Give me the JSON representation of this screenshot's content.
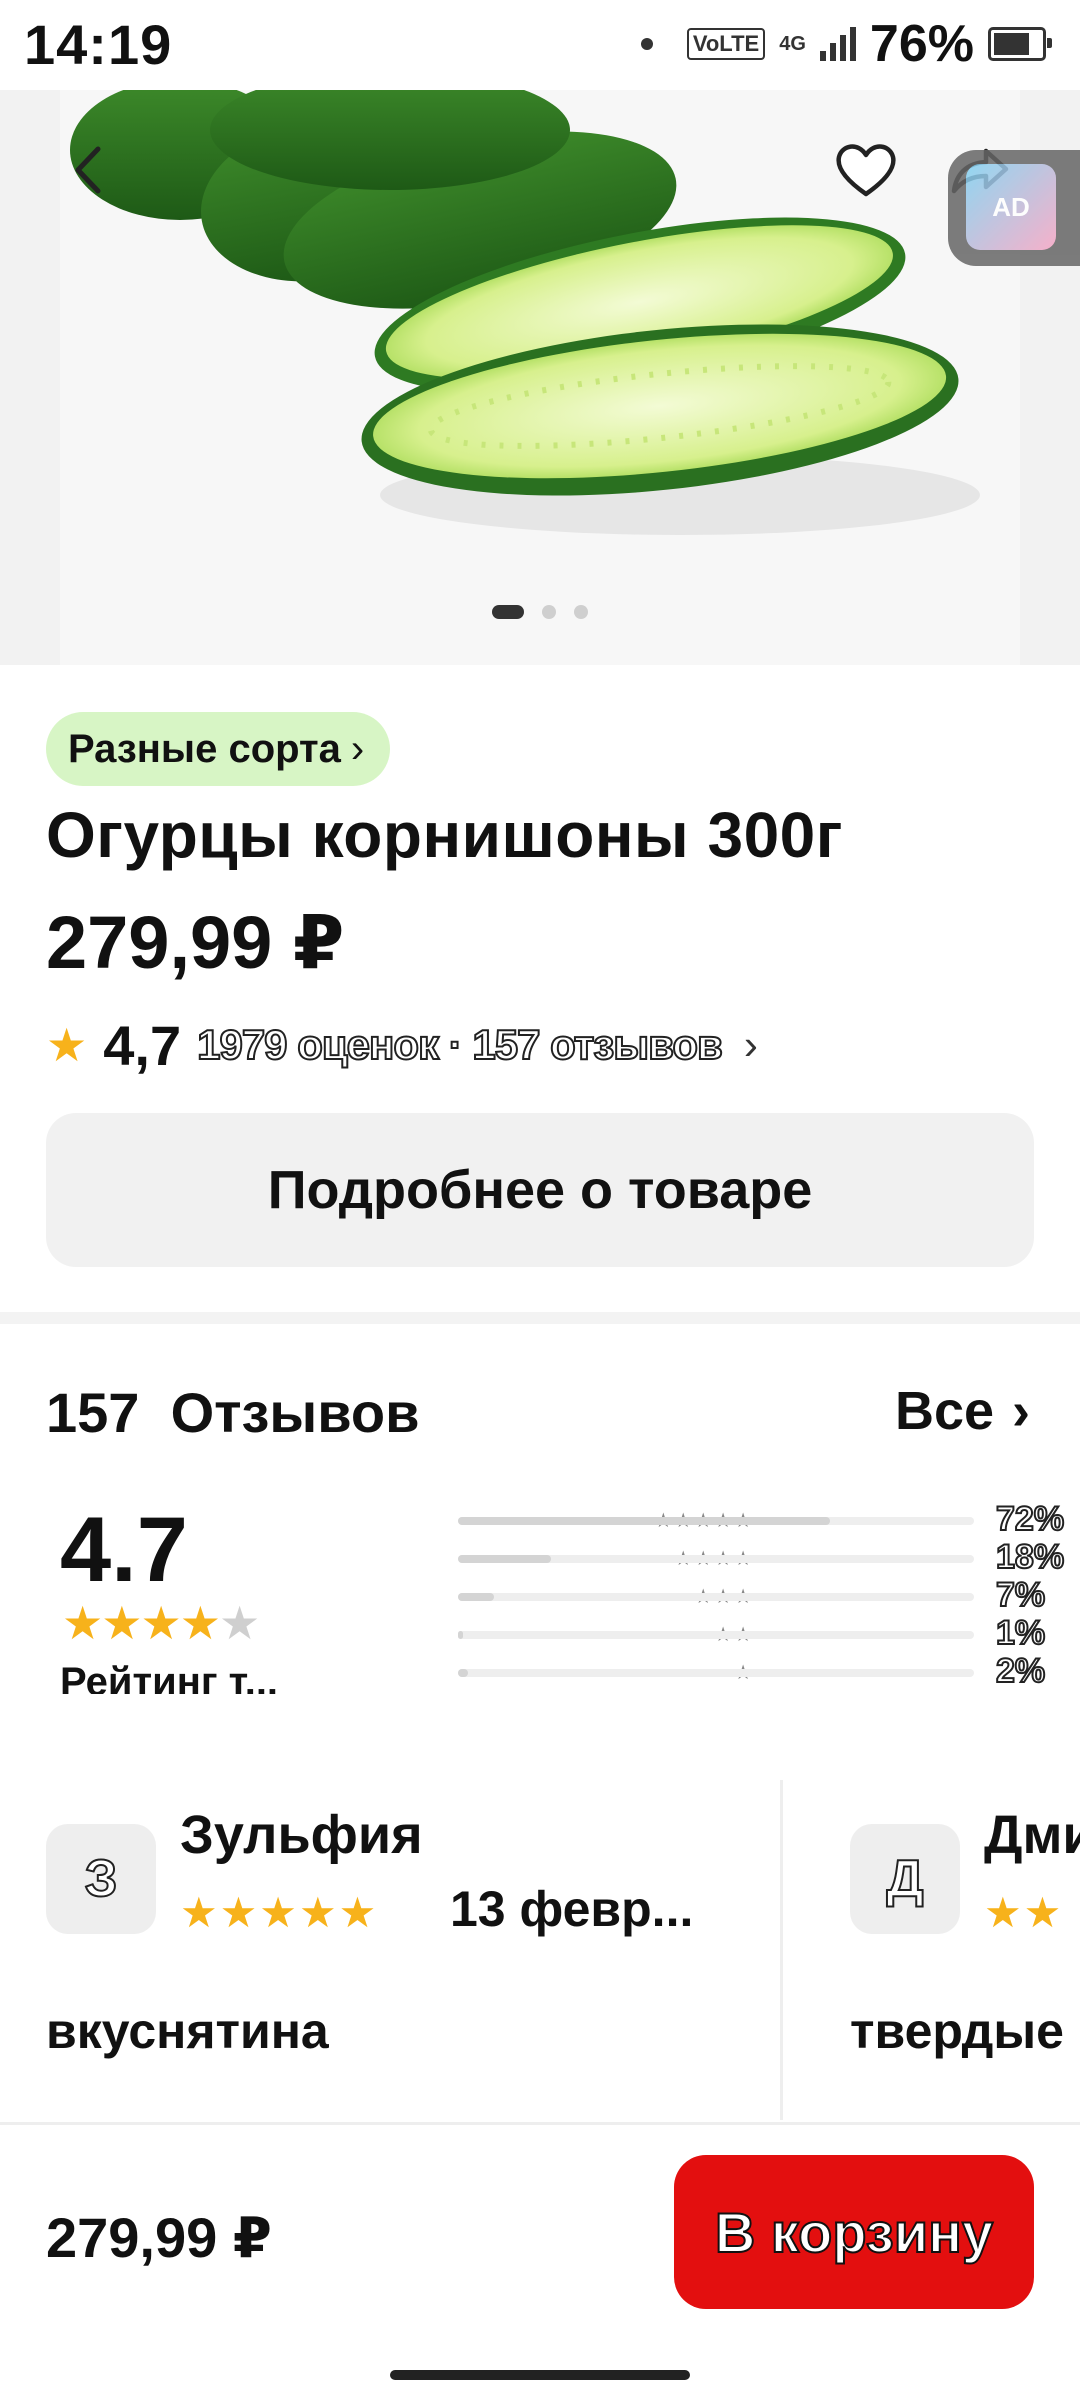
{
  "status_bar": {
    "time": "14:19",
    "volte": "VoLTE",
    "network": "4G",
    "battery": "76%",
    "battery_level": 0.76
  },
  "hero": {
    "icons": [
      "back-icon",
      "heart-icon",
      "share-icon"
    ],
    "ad_badge": "AD",
    "slide_count": 3,
    "active_slide": 1
  },
  "product": {
    "variety_chip": "Разные сорта",
    "title": "Огурцы корнишоны 300г",
    "price": "279,99 ₽",
    "rating": "4,7",
    "rating_meta": "1979 оценок · 157 отзывов",
    "details_button": "Подробнее о товаре"
  },
  "reviews": {
    "count": "157",
    "title": "Отзывов",
    "all_label": "Все",
    "average": "4.7",
    "stars_filled": 4,
    "rating_caption": "Рейтинг т...",
    "distribution": [
      {
        "stars": "★★★★★",
        "percent": "72%",
        "value": 0.72
      },
      {
        "stars": "★★★★",
        "percent": "18%",
        "value": 0.18
      },
      {
        "stars": "★★★",
        "percent": "7%",
        "value": 0.07
      },
      {
        "stars": "★★",
        "percent": "1%",
        "value": 0.01
      },
      {
        "stars": "★",
        "percent": "2%",
        "value": 0.02
      }
    ],
    "items": [
      {
        "initial": "З",
        "name": "Зульфия",
        "stars": "★★★★★",
        "date": "13 февр...",
        "text": "вкуснятина"
      },
      {
        "initial": "Д",
        "name": "Дми",
        "stars": "★★",
        "date": "",
        "text": "твердые"
      }
    ]
  },
  "bottom_bar": {
    "price": "279,99 ₽",
    "cart_button": "В корзину"
  },
  "colors": {
    "accent_red": "#e30f0f",
    "star_yellow": "#f7b21b",
    "chip_green": "#d7f5c5"
  }
}
